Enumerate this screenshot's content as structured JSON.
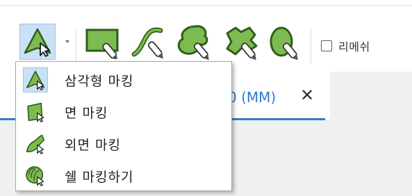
{
  "toolbar": {
    "tools": [
      {
        "name": "triangle-marking-tool",
        "icon": "triangle-marking-icon",
        "active": true,
        "has_dropdown": true
      },
      {
        "name": "face-marking-tool",
        "icon": "face-marking-icon",
        "active": false
      },
      {
        "name": "curve-marking-tool",
        "icon": "curve-marking-icon",
        "active": false
      },
      {
        "name": "region-marking-tool",
        "icon": "region-marking-icon",
        "active": false
      },
      {
        "name": "freeform-region-tool",
        "icon": "freeform-region-icon",
        "active": false
      },
      {
        "name": "shell-face-tool",
        "icon": "shell-face-icon",
        "active": false
      }
    ],
    "remesh_label": "리메쉬",
    "remesh_checked": false
  },
  "tab": {
    "title": "0 (MM)",
    "close_symbol": "✕"
  },
  "dropdown_menu": {
    "items": [
      {
        "label": "삼각형 마킹",
        "icon": "triangle-marking-icon"
      },
      {
        "label": "면 마킹",
        "icon": "face-marking-icon"
      },
      {
        "label": "외면 마킹",
        "icon": "outer-face-marking-icon"
      },
      {
        "label": "쉘 마킹하기",
        "icon": "shell-marking-icon"
      }
    ]
  },
  "colors": {
    "icon_green": "#7dbb50",
    "icon_outline": "#2f5d1c",
    "accent_blue": "#2b7cd3",
    "active_bg": "#c9e0f5"
  }
}
